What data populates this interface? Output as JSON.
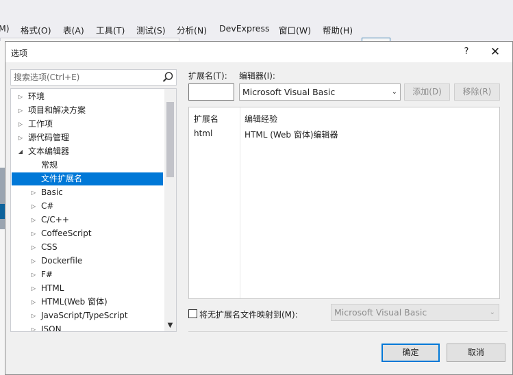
{
  "menubar": {
    "items": [
      "M)",
      "格式(O)",
      "表(A)",
      "工具(T)",
      "测试(S)",
      "分析(N)",
      "DevExpress",
      "窗口(W)",
      "帮助(H)"
    ]
  },
  "dialog": {
    "title": "选项",
    "help_label": "?",
    "close_label": "✕"
  },
  "search": {
    "placeholder": "搜索选项(Ctrl+E)"
  },
  "tree": {
    "items": [
      {
        "label": "环境",
        "level": 0,
        "expanded": false
      },
      {
        "label": "项目和解决方案",
        "level": 0,
        "expanded": false
      },
      {
        "label": "工作项",
        "level": 0,
        "expanded": false
      },
      {
        "label": "源代码管理",
        "level": 0,
        "expanded": false
      },
      {
        "label": "文本编辑器",
        "level": 0,
        "expanded": true
      },
      {
        "label": "常规",
        "level": 1,
        "leaf": true
      },
      {
        "label": "文件扩展名",
        "level": 1,
        "leaf": true,
        "selected": true
      },
      {
        "label": "Basic",
        "level": 1,
        "expanded": false
      },
      {
        "label": "C#",
        "level": 1,
        "expanded": false
      },
      {
        "label": "C/C++",
        "level": 1,
        "expanded": false
      },
      {
        "label": "CoffeeScript",
        "level": 1,
        "expanded": false
      },
      {
        "label": "CSS",
        "level": 1,
        "expanded": false
      },
      {
        "label": "Dockerfile",
        "level": 1,
        "expanded": false
      },
      {
        "label": "F#",
        "level": 1,
        "expanded": false
      },
      {
        "label": "HTML",
        "level": 1,
        "expanded": false
      },
      {
        "label": "HTML(Web 窗体)",
        "level": 1,
        "expanded": false
      },
      {
        "label": "JavaScript/TypeScript",
        "level": 1,
        "expanded": false
      },
      {
        "label": "JSON",
        "level": 1,
        "expanded": false
      }
    ]
  },
  "ext": {
    "label": "扩展名(T):",
    "value": ""
  },
  "editor": {
    "label": "编辑器(I):",
    "selected": "Microsoft Visual Basic"
  },
  "buttons": {
    "add": "添加(D)",
    "remove": "移除(R)",
    "ok": "确定",
    "cancel": "取消"
  },
  "list": {
    "headers": [
      "扩展名",
      "编辑经验"
    ],
    "rows": [
      [
        "html",
        "HTML (Web 窗体)编辑器"
      ]
    ]
  },
  "map": {
    "label": "将无扩展名文件映射到(M):",
    "checked": false,
    "selected": "Microsoft Visual Basic"
  },
  "colors": {
    "selection": "#0078d7",
    "focus_border": "#0078d7"
  }
}
